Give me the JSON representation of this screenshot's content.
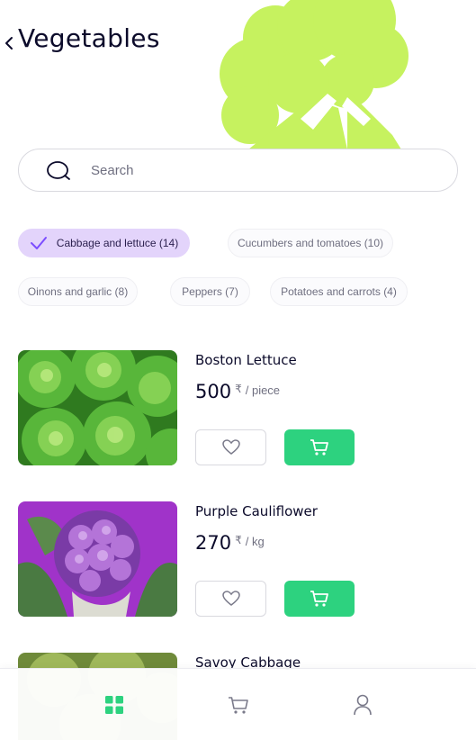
{
  "header": {
    "title": "Vegetables",
    "back_icon": "chevron-left-icon",
    "hero_icon": "broccoli-illustration"
  },
  "search": {
    "placeholder": "Search",
    "value": "",
    "icon": "search-icon"
  },
  "categories": [
    {
      "label": "Cabbage and lettuce (14)",
      "selected": true
    },
    {
      "label": "Cucumbers and tomatoes (10)",
      "selected": false
    },
    {
      "label": "Oinons and garlic (8)",
      "selected": false
    },
    {
      "label": "Peppers (7)",
      "selected": false
    },
    {
      "label": "Potatoes and carrots (4)",
      "selected": false
    }
  ],
  "products": [
    {
      "name": "Boston Lettuce",
      "price": "500",
      "currency": "₹",
      "unit": "/ piece",
      "image": "boston-lettuce-photo"
    },
    {
      "name": "Purple Cauliflower",
      "price": "270",
      "currency": "₹",
      "unit": "/ kg",
      "image": "purple-cauliflower-photo"
    },
    {
      "name": "Savoy Cabbage",
      "image": "savoy-cabbage-photo"
    }
  ],
  "bottom_nav": {
    "items": [
      {
        "icon": "grid-icon",
        "active": true
      },
      {
        "icon": "cart-icon",
        "active": false
      },
      {
        "icon": "profile-icon",
        "active": false
      }
    ]
  },
  "colors": {
    "accent_green": "#2dd27f",
    "hero_green": "#c6f25f",
    "chip_selected": "#e3d4fb",
    "nav_active": "#2dd27f",
    "text_primary": "#0b0a2a",
    "text_secondary": "#6f6f80"
  }
}
